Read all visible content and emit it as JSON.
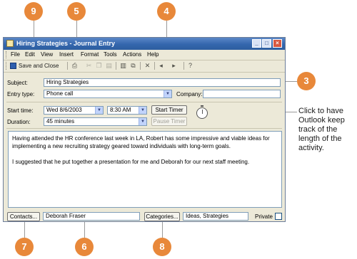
{
  "window": {
    "title": "Hiring Strategies - Journal Entry",
    "controls": {
      "minimize": "_",
      "maximize": "□",
      "close": "×"
    }
  },
  "menu": [
    "File",
    "Edit",
    "View",
    "Insert",
    "Format",
    "Tools",
    "Actions",
    "Help"
  ],
  "toolbar": {
    "save_close_label": "Save and Close",
    "icons": [
      "print-icon",
      "cut-icon",
      "copy-icon",
      "paste-icon",
      "format-icon",
      "attach-icon",
      "delete-icon",
      "previous-item-icon",
      "next-item-icon",
      "help-icon"
    ]
  },
  "form": {
    "subject_label": "Subject:",
    "subject_value": "Hiring Strategies",
    "entry_type_label": "Entry type:",
    "entry_type_value": "Phone call",
    "company_label": "Company:",
    "company_value": "",
    "start_time_label": "Start time:",
    "start_date_value": "Wed 8/6/2003",
    "start_clock_value": "8:30 AM",
    "duration_label": "Duration:",
    "duration_value": "45 minutes",
    "start_timer_label": "Start Timer",
    "pause_timer_label": "Pause Timer"
  },
  "notes": {
    "paragraphs": [
      "Having attended the HR conference last week in LA, Robert has some impressive and viable ideas for implementing a new recruiting strategy geared toward individuals with long-term goals.",
      "I suggested that he put together a presentation for me and Deborah for our next staff meeting."
    ]
  },
  "footer": {
    "contacts_label": "Contacts...",
    "contacts_value": "Deborah Fraser",
    "categories_label": "Categories...",
    "categories_value": "Ideas, Strategies",
    "private_label": "Private"
  },
  "callouts": [
    "9",
    "5",
    "4",
    "3",
    "7",
    "6",
    "8"
  ],
  "side_note": "Click to have Outlook keep track of the length of the activity.",
  "colors": {
    "callout": "#e8883a",
    "titlebar": "#3466ad"
  }
}
